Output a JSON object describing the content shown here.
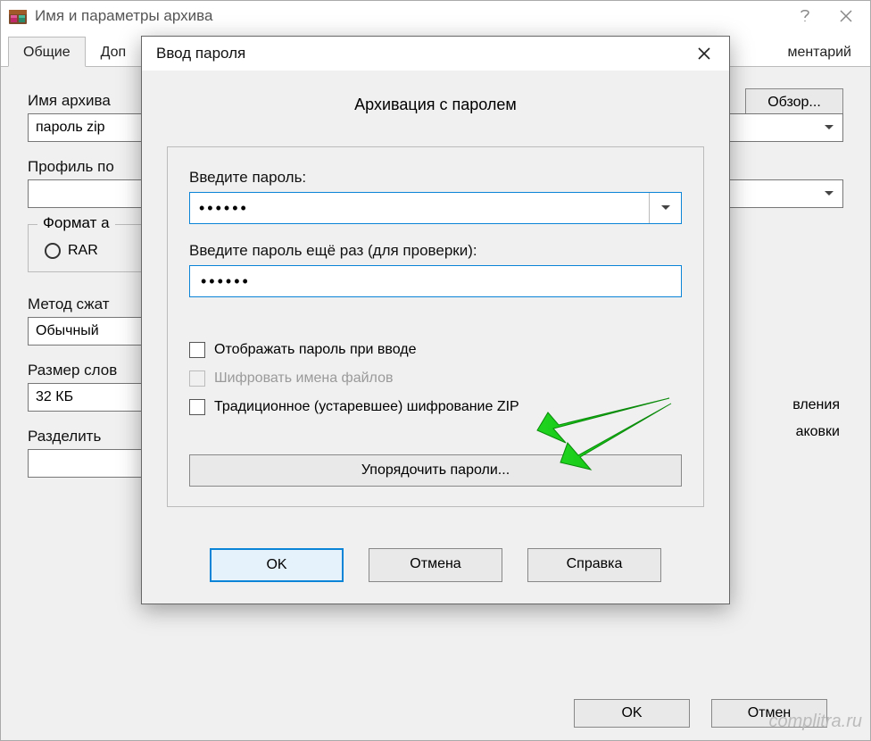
{
  "parent": {
    "title": "Имя и параметры архива",
    "tabs": {
      "general": "Общие",
      "advanced_partial": "Доп",
      "comment_partial": "ментарий"
    },
    "archive_name_label": "Имя архива",
    "archive_name_value": "пароль zip",
    "browse_label": "Обзор...",
    "profile_label": "Профиль по",
    "format_group": "Формат а",
    "format_rar": "RAR",
    "method_label": "Метод сжат",
    "method_value": "Обычный",
    "dict_label": "Размер слов",
    "dict_value": "32 КБ",
    "split_label": "Разделить",
    "side_text_1": "вления",
    "side_text_2": "аковки",
    "footer": {
      "ok": "OK",
      "cancel": "Отмен"
    }
  },
  "dialog": {
    "title": "Ввод пароля",
    "heading": "Архивация с паролем",
    "enter_pw_label": "Введите пароль:",
    "enter_pw_value": "••••••",
    "confirm_pw_label": "Введите пароль ещё раз (для проверки):",
    "confirm_pw_value": "••••••",
    "show_pw": "Отображать пароль при вводе",
    "encrypt_names": "Шифровать имена файлов",
    "legacy_zip": "Традиционное (устаревшее) шифрование ZIP",
    "organize": "Упорядочить пароли...",
    "ok": "OK",
    "cancel": "Отмена",
    "help": "Справка"
  },
  "watermark": "complitra.ru"
}
